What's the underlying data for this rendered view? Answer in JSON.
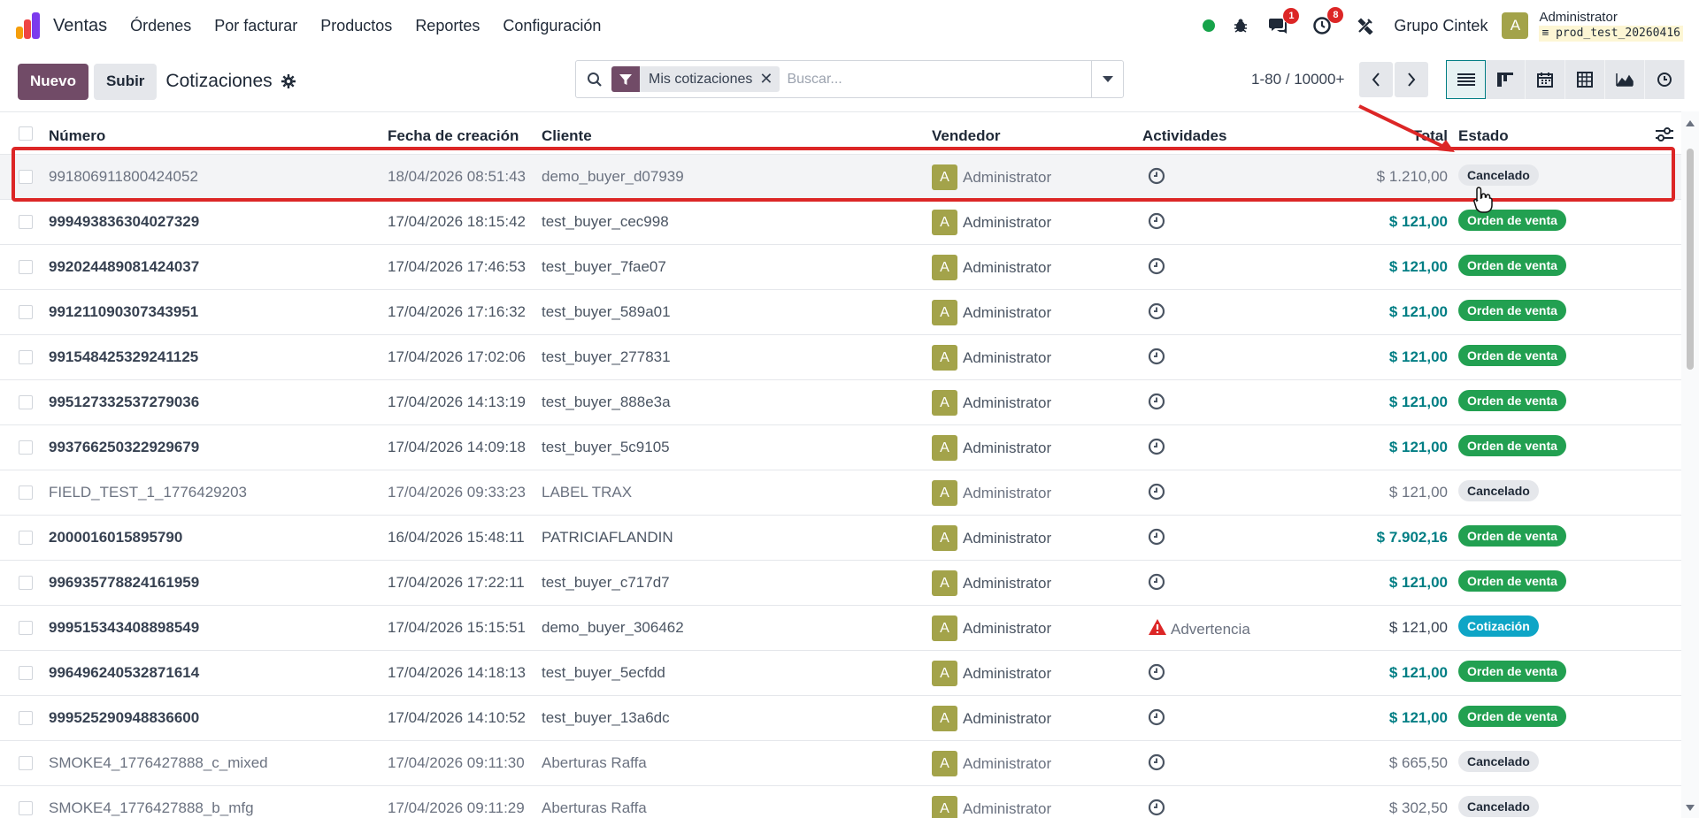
{
  "navbar": {
    "app_name": "Ventas",
    "menu": [
      "Órdenes",
      "Por facturar",
      "Productos",
      "Reportes",
      "Configuración"
    ],
    "messages_badge": "1",
    "activities_badge": "8",
    "company": "Grupo Cintek",
    "user_initial": "A",
    "user_name": "Administrator",
    "database": "prod_test_20260416"
  },
  "control_panel": {
    "new_label": "Nuevo",
    "upload_label": "Subir",
    "title": "Cotizaciones",
    "search": {
      "facet_label": "Mis cotizaciones",
      "placeholder": "Buscar..."
    },
    "pager": "1-80 / 10000+"
  },
  "table": {
    "columns": {
      "number": "Número",
      "created": "Fecha de creación",
      "client": "Cliente",
      "salesperson": "Vendedor",
      "activities": "Actividades",
      "total": "Total",
      "state": "Estado"
    },
    "rows": [
      {
        "number": "991806911800424052",
        "created": "18/04/2026 08:51:43",
        "client": "demo_buyer_d07939",
        "vendor": "Administrator",
        "activity": "",
        "total": "$ 1.210,00",
        "state": "Cancelado"
      },
      {
        "number": "999493836304027329",
        "created": "17/04/2026 18:15:42",
        "client": "test_buyer_cec998",
        "vendor": "Administrator",
        "activity": "",
        "total": "$ 121,00",
        "state": "Orden de venta"
      },
      {
        "number": "992024489081424037",
        "created": "17/04/2026 17:46:53",
        "client": "test_buyer_7fae07",
        "vendor": "Administrator",
        "activity": "",
        "total": "$ 121,00",
        "state": "Orden de venta"
      },
      {
        "number": "991211090307343951",
        "created": "17/04/2026 17:16:32",
        "client": "test_buyer_589a01",
        "vendor": "Administrator",
        "activity": "",
        "total": "$ 121,00",
        "state": "Orden de venta"
      },
      {
        "number": "991548425329241125",
        "created": "17/04/2026 17:02:06",
        "client": "test_buyer_277831",
        "vendor": "Administrator",
        "activity": "",
        "total": "$ 121,00",
        "state": "Orden de venta"
      },
      {
        "number": "995127332537279036",
        "created": "17/04/2026 14:13:19",
        "client": "test_buyer_888e3a",
        "vendor": "Administrator",
        "activity": "",
        "total": "$ 121,00",
        "state": "Orden de venta"
      },
      {
        "number": "993766250322929679",
        "created": "17/04/2026 14:09:18",
        "client": "test_buyer_5c9105",
        "vendor": "Administrator",
        "activity": "",
        "total": "$ 121,00",
        "state": "Orden de venta"
      },
      {
        "number": "FIELD_TEST_1_1776429203",
        "created": "17/04/2026 09:33:23",
        "client": "LABEL TRAX",
        "vendor": "Administrator",
        "activity": "",
        "total": "$ 121,00",
        "state": "Cancelado"
      },
      {
        "number": "2000016015895790",
        "created": "16/04/2026 15:48:11",
        "client": "PATRICIAFLANDIN",
        "vendor": "Administrator",
        "activity": "",
        "total": "$ 7.902,16",
        "state": "Orden de venta"
      },
      {
        "number": "996935778824161959",
        "created": "17/04/2026 17:22:11",
        "client": "test_buyer_c717d7",
        "vendor": "Administrator",
        "activity": "",
        "total": "$ 121,00",
        "state": "Orden de venta"
      },
      {
        "number": "999515343408898549",
        "created": "17/04/2026 15:15:51",
        "client": "demo_buyer_306462",
        "vendor": "Administrator",
        "activity": "Advertencia",
        "total": "$ 121,00",
        "state": "Cotización"
      },
      {
        "number": "996496240532871614",
        "created": "17/04/2026 14:18:13",
        "client": "test_buyer_5ecfdd",
        "vendor": "Administrator",
        "activity": "",
        "total": "$ 121,00",
        "state": "Orden de venta"
      },
      {
        "number": "999525290948836600",
        "created": "17/04/2026 14:10:52",
        "client": "test_buyer_13a6dc",
        "vendor": "Administrator",
        "activity": "",
        "total": "$ 121,00",
        "state": "Orden de venta"
      },
      {
        "number": "SMOKE4_1776427888_c_mixed",
        "created": "17/04/2026 09:11:30",
        "client": "Aberturas Raffa",
        "vendor": "Administrator",
        "activity": "",
        "total": "$ 665,50",
        "state": "Cancelado"
      },
      {
        "number": "SMOKE4_1776427888_b_mfg",
        "created": "17/04/2026 09:11:29",
        "client": "Aberturas Raffa",
        "vendor": "Administrator",
        "activity": "",
        "total": "$ 302,50",
        "state": "Cancelado"
      }
    ]
  },
  "colors": {
    "brand": "#714b67",
    "accent": "#017e84",
    "order_state": "#22a051",
    "quote_state": "#0ea5c6",
    "annotation": "#dc2626"
  }
}
